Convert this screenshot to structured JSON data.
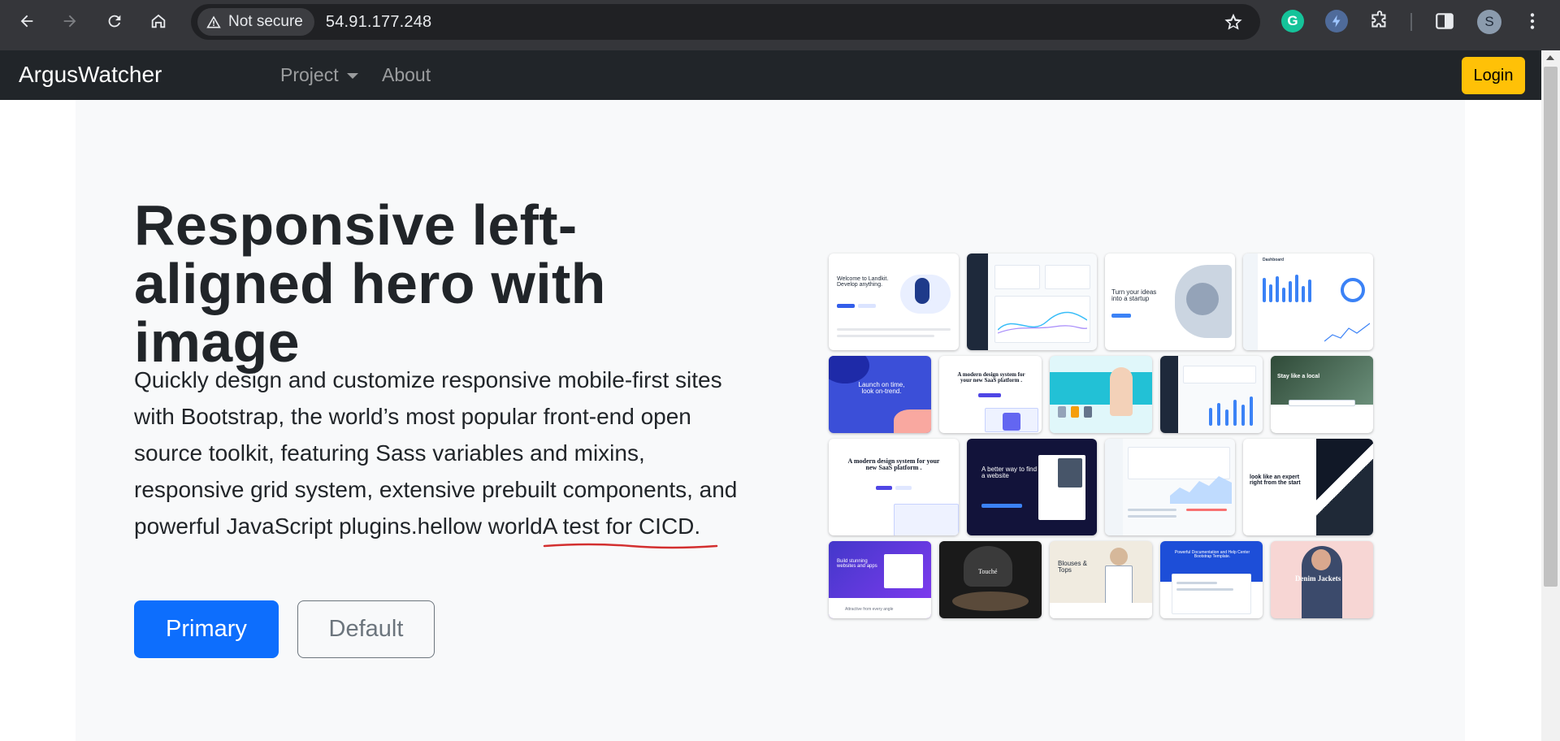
{
  "browser": {
    "security_label": "Not secure",
    "url": "54.91.177.248",
    "profile_initial": "S",
    "grammarly_letter": "G"
  },
  "navbar": {
    "brand": "ArgusWatcher",
    "items": [
      {
        "label": "Project",
        "dropdown": true
      },
      {
        "label": "About",
        "dropdown": false
      }
    ],
    "login_label": "Login",
    "colors": {
      "background": "#212529",
      "login": "#ffc107"
    }
  },
  "hero": {
    "title": "Responsive left-aligned hero with image",
    "lead_main": "Quickly design and customize responsive mobile-first sites with Bootstrap, the world’s most popular front-end open source toolkit, featuring Sass variables and mixins, responsive grid system, extensive prebuilt components, and powerful JavaScript plugins.hellow world",
    "lead_highlight": " A test for CICD.",
    "primary_label": "Primary",
    "default_label": "Default",
    "colors": {
      "primary": "#0d6efd",
      "background": "#f8f9fa",
      "highlight_underline": "#d32f2f"
    }
  },
  "mosaic": {
    "tiles": [
      {
        "title": "Welcome to Landkit. Develop anything.",
        "theme": "light"
      },
      {
        "title": "",
        "theme": "dashboard-dark-sidebar"
      },
      {
        "title": "Turn your ideas into a startup",
        "theme": "light"
      },
      {
        "title": "Dashboard",
        "theme": "light-dashboard"
      },
      {
        "title": "Launch on time, look on-trend.",
        "theme": "blue"
      },
      {
        "title": "A modern design system for your new SaaS platform .",
        "theme": "light"
      },
      {
        "title": "",
        "theme": "teal"
      },
      {
        "title": "",
        "theme": "dashboard-dark-sidebar"
      },
      {
        "title": "Stay like a local",
        "theme": "photo"
      },
      {
        "title": "A modern design system for your new SaaS platform .",
        "theme": "light"
      },
      {
        "title": "A better way to find a website",
        "theme": "navy"
      },
      {
        "title": "",
        "theme": "light-dashboard"
      },
      {
        "title": "look like an expert right from the start",
        "theme": "light"
      },
      {
        "title": "Build stunning websites and apps",
        "theme": "purple"
      },
      {
        "title": "Touché",
        "theme": "dark-photo"
      },
      {
        "title": "Blouses & Tops",
        "theme": "beige"
      },
      {
        "title": "Powerful Documentation and Help Center Bootstrap Template.",
        "theme": "blue"
      },
      {
        "title": "Denim Jackets",
        "theme": "pink"
      }
    ],
    "caption_small": "Attractive from every angle"
  }
}
